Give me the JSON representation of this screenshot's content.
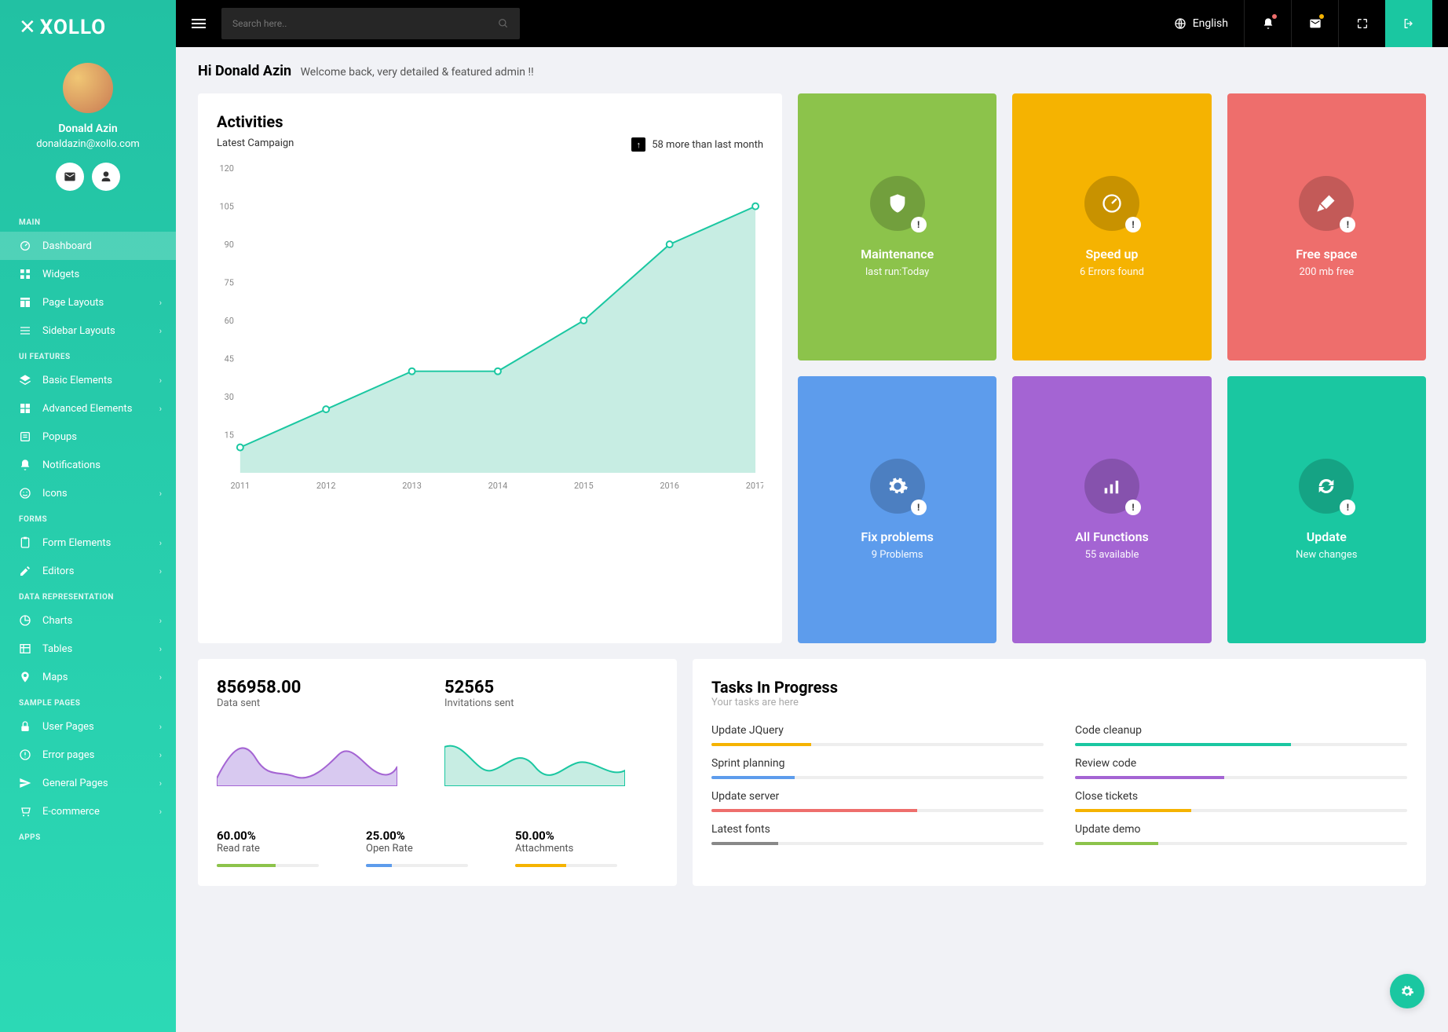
{
  "brand": {
    "name": "XOLLO"
  },
  "user": {
    "name": "Donald Azin",
    "email": "donaldazin@xollo.com"
  },
  "topbar": {
    "search_placeholder": "Search here..",
    "language": "English"
  },
  "greeting": {
    "name": "Hi Donald Azin",
    "text": "Welcome back, very detailed & featured admin !!"
  },
  "sidebar": {
    "sections": {
      "main": "MAIN",
      "ui_features": "UI FEATURES",
      "forms": "FORMS",
      "data_representation": "DATA REPRESENTATION",
      "sample_pages": "SAMPLE PAGES",
      "apps": "APPS"
    },
    "items": {
      "dashboard": "Dashboard",
      "widgets": "Widgets",
      "page_layouts": "Page Layouts",
      "sidebar_layouts": "Sidebar Layouts",
      "basic_elements": "Basic Elements",
      "advanced_elements": "Advanced Elements",
      "popups": "Popups",
      "notifications": "Notifications",
      "icons": "Icons",
      "form_elements": "Form Elements",
      "editors": "Editors",
      "charts": "Charts",
      "tables": "Tables",
      "maps": "Maps",
      "user_pages": "User Pages",
      "error_pages": "Error pages",
      "general_pages": "General Pages",
      "ecommerce": "E-commerce"
    }
  },
  "activities": {
    "title": "Activities",
    "subtitle": "Latest Campaign",
    "delta": "58 more than last month"
  },
  "chart_data": {
    "type": "line",
    "title": "Activities — Latest Campaign",
    "categories": [
      "2011",
      "2012",
      "2013",
      "2014",
      "2015",
      "2016",
      "2017"
    ],
    "values": [
      10,
      25,
      40,
      40,
      60,
      90,
      105
    ],
    "ylabel": "",
    "xlabel": "",
    "ylim": [
      0,
      120
    ],
    "y_ticks": [
      15,
      30,
      45,
      60,
      75,
      90,
      105,
      120
    ]
  },
  "tiles": [
    {
      "title": "Maintenance",
      "sub": "last run:Today",
      "color": "#8cc34b",
      "icon": "shield"
    },
    {
      "title": "Speed up",
      "sub": "6 Errors found",
      "color": "#f5b301",
      "icon": "gauge"
    },
    {
      "title": "Free space",
      "sub": "200 mb free",
      "color": "#ee6e6c",
      "icon": "brush"
    },
    {
      "title": "Fix problems",
      "sub": "9 Problems",
      "color": "#5d9cec",
      "icon": "gear"
    },
    {
      "title": "All Functions",
      "sub": "55 available",
      "color": "#a464d3",
      "icon": "bars"
    },
    {
      "title": "Update",
      "sub": "New changes",
      "color": "#1ac7a1",
      "icon": "refresh"
    }
  ],
  "stats": {
    "data_sent": {
      "value": "856958.00",
      "label": "Data sent"
    },
    "invitations": {
      "value": "52565",
      "label": "Invitations sent"
    },
    "read_rate": {
      "pct": "60.00%",
      "label": "Read rate",
      "fill": 58,
      "color": "#8cc34b"
    },
    "open_rate": {
      "pct": "25.00%",
      "label": "Open Rate",
      "fill": 25,
      "color": "#5d9cec"
    },
    "attachments": {
      "pct": "50.00%",
      "label": "Attachments",
      "fill": 50,
      "color": "#f5b301"
    }
  },
  "tasks": {
    "title": "Tasks In Progress",
    "subtitle": "Your tasks are here",
    "items": [
      {
        "name": "Update JQuery",
        "pct": 30,
        "color": "#f5b301"
      },
      {
        "name": "Code cleanup",
        "pct": 65,
        "color": "#1ac7a1"
      },
      {
        "name": "Sprint planning",
        "pct": 25,
        "color": "#5d9cec"
      },
      {
        "name": "Review code",
        "pct": 45,
        "color": "#a464d3"
      },
      {
        "name": "Update server",
        "pct": 62,
        "color": "#ee6e6c"
      },
      {
        "name": "Close tickets",
        "pct": 35,
        "color": "#f5b301"
      },
      {
        "name": "Latest fonts",
        "pct": 20,
        "color": "#888"
      },
      {
        "name": "Update demo",
        "pct": 25,
        "color": "#8cc34b"
      }
    ]
  }
}
